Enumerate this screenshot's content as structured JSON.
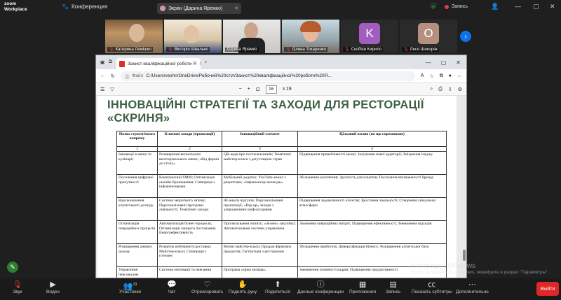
{
  "topbar": {
    "logo_line1": "zoom",
    "logo_line2": "Workplace",
    "conference_label": "Конференция",
    "screen_tab_label": "Экран (Дарина Яремко)",
    "record_label": "Запись",
    "participants_count_icon": "people-icon"
  },
  "participants": [
    {
      "name": "Катерина Лемішко",
      "muted": true
    },
    {
      "name": "Вікторія Швалько",
      "muted": true
    },
    {
      "name": "Дарина Яремко",
      "muted": false
    },
    {
      "name": "Олена Токаренко",
      "muted": true
    },
    {
      "name": "Скобієв Кирило",
      "muted": true,
      "initial": "K",
      "color": "#a05fc0"
    },
    {
      "name": "Леся Шикоряк",
      "muted": true,
      "initial": "O",
      "color": "#b5907e"
    }
  ],
  "browser": {
    "tab_title": "Захист кваліфікаційної роботи Я",
    "url_label": "Файл",
    "url": "C:/Users/veshn/OneDrive/Робочий%20стіл/Захист%20кваліфікаційної%20роботи%20Я...",
    "page_current": "16",
    "page_total": "з 19"
  },
  "slide": {
    "title": "ІННОВАЦІЙНІ СТРАТЕГІЇ ТА ЗАХОДИ ДЛЯ РЕСТОРАЦІЇ «СКРИНЯ»",
    "table": {
      "headers": [
        "Назва стратегічного напряму",
        "Ключові заходи (пропозиції)",
        "Інноваційний елемент",
        "Цільовий вплив (на що спрямовано)"
      ],
      "numbers": [
        "1",
        "2",
        "3",
        "4"
      ],
      "rows": [
        [
          "Інновації в меню та кулінарії",
          "Розширення веганського/вегетаріанського меню; «Від ферми до столу»",
          "QR-коди про постачальників; Тематичні майстер-класи з дегустацією страв",
          "Підвищення привабливості меню; Залучення нової аудиторії; Зміцнення іміджу"
        ],
        [
          "Посилення цифрової присутності",
          "Комплексний SMM; Оптимізація онлайн-бронювання; Співпраця з інфлюенсерами",
          "Мобільний додаток; YouTube-канал з рецептами; «Інфлюенсер-челендж»",
          "Збільшення охоплення; Зручність для клієнтів; Посилення впізнаваності бренду"
        ],
        [
          "Вдосконалення клієнтського досвіду",
          "Система зворотного зв'язку; Персоналізовані програми лояльності; Тематичні заходи",
          "AI-аналіз відгуків; Персоналізовані пропозиції; «Pop-up» заходи з запрошеними шеф-кухарями",
          "Підвищення задоволеності клієнтів; Зростання лояльності; Створення унікальної атмосфери"
        ],
        [
          "Оптимізація операційних процесів",
          "Автоматизація бізнес-процесів; Оптимізація ланцюга постачання; Енергоефективність",
          "Прогнозування попиту; «Зелені» закупівлі; Автоматизовані системи управління",
          "Зниження операційних витрат; Підвищення ефективності; Зменшення відходів"
        ],
        [
          "Розширення джерел доходу",
          "Розвиток кейтерингу/доставки; Майстер-класи; Співпраця з готелем",
          "Виїзні майстер-класи; Продаж фірмових продуктів; Гастротури з рестораном",
          "Збільшення прибутків; Диверсифікація бізнесу; Розширення клієнтської бази"
        ],
        [
          "Управління персоналом",
          "Система мотивації та навчання",
          "Програма «зірка місяця»;",
          "Зменшення плинності кадрів; Підвищення продуктивності"
        ]
      ]
    }
  },
  "toolbar": {
    "audio": "Звук",
    "video": "Видео",
    "participants": "Участники",
    "participants_count": "13",
    "chat": "Чат",
    "react": "Отреагировать",
    "raise_hand": "Поднять руку",
    "share": "Поделиться",
    "conf_data": "Данные конференции",
    "apps": "Приложения",
    "notes": "Запись",
    "captions": "Показать субтитры",
    "more": "Дополнительно",
    "leave": "Выйти"
  },
  "watermark": {
    "title": "Активация Windows",
    "subtitle": "Чтобы активировать Windows, перейдите в раздел \"Параметры\"."
  }
}
